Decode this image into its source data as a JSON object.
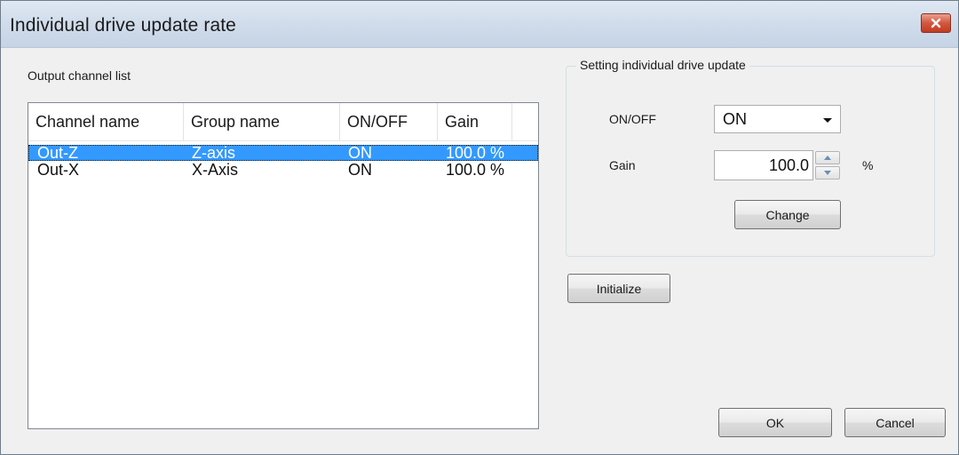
{
  "window": {
    "title": "Individual drive update rate"
  },
  "output_list": {
    "label": "Output channel list",
    "columns": [
      "Channel name",
      "Group name",
      "ON/OFF",
      "Gain"
    ],
    "rows": [
      {
        "channel": "Out-Z",
        "group": "Z-axis",
        "state": "ON",
        "gain": "100.0 %",
        "selected": true
      },
      {
        "channel": "Out-X",
        "group": "X-Axis",
        "state": "ON",
        "gain": "100.0 %",
        "selected": false
      }
    ]
  },
  "settings": {
    "group_title": "Setting individual drive update",
    "onoff_label": "ON/OFF",
    "onoff_value": "ON",
    "gain_label": "Gain",
    "gain_value": "100.0",
    "gain_unit": "%",
    "change_button": "Change"
  },
  "buttons": {
    "initialize": "Initialize",
    "ok": "OK",
    "cancel": "Cancel"
  },
  "colors": {
    "selection": "#3399ff",
    "close_button": "#c13c22",
    "titlebar": "#cfdbea"
  },
  "icons": {
    "close": "close-icon",
    "dropdown": "chevron-down-icon",
    "spin_up": "spin-up-icon",
    "spin_down": "spin-down-icon"
  }
}
